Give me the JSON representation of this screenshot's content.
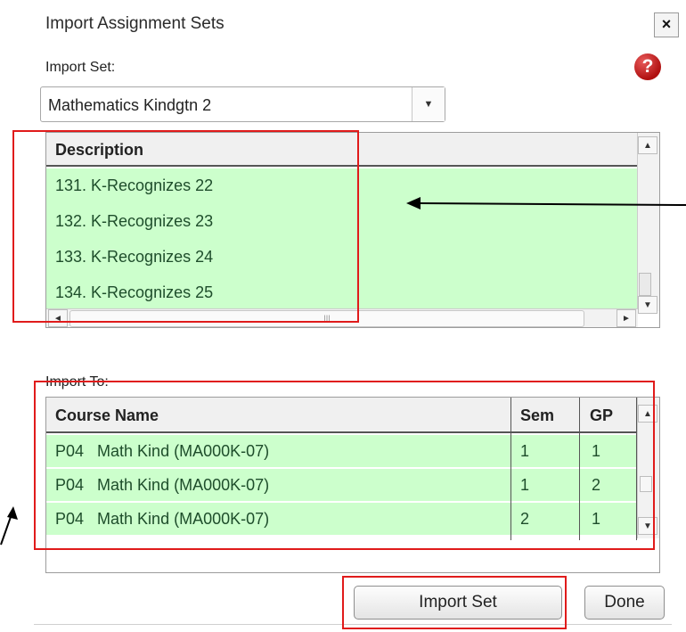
{
  "dialog": {
    "title": "Import Assignment Sets",
    "close_label": "×"
  },
  "help_icon": {
    "glyph": "?"
  },
  "import_set": {
    "label": "Import Set:",
    "selected": "Mathematics Kindgtn 2",
    "dropdown_glyph": "▼"
  },
  "description_grid": {
    "header": "Description",
    "rows": [
      "131. K-Recognizes 22",
      "132. K-Recognizes 23",
      "133. K-Recognizes 24",
      "134. K-Recognizes 25"
    ],
    "scroll_glyphs": {
      "up": "▲",
      "down": "▼",
      "left": "◄",
      "right": "►",
      "hthumb": "III"
    }
  },
  "import_to": {
    "label": "Import To:",
    "columns": [
      "Course Name",
      "Sem",
      "GP"
    ],
    "rows": [
      {
        "course": "P04   Math Kind (MA000K-07)",
        "sem": "1",
        "gp": "1"
      },
      {
        "course": "P04   Math Kind (MA000K-07)",
        "sem": "1",
        "gp": "2"
      },
      {
        "course": "P04   Math Kind (MA000K-07)",
        "sem": "2",
        "gp": "1"
      }
    ]
  },
  "buttons": {
    "import_set": "Import Set",
    "done": "Done"
  },
  "colors": {
    "row_bg": "#ccffcc",
    "annotation_red": "#e01b1b",
    "help_red": "#b01010"
  }
}
